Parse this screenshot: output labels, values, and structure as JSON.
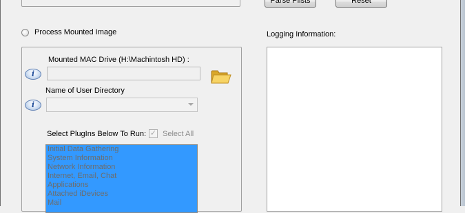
{
  "toolbar": {
    "parse_label": "Parse Plists",
    "reset_label": "Reset"
  },
  "process_mounted": {
    "label": "Process Mounted Image",
    "checked": false
  },
  "mounted_drive": {
    "label": "Mounted MAC Drive (H:\\Machintosh HD) :",
    "value": ""
  },
  "user_directory": {
    "label": "Name of User Directory",
    "value": ""
  },
  "plugins": {
    "label": "Select PlugIns Below To Run:",
    "select_all_label": "Select All",
    "select_all_checked": true,
    "items": [
      "Initial Data Gathering",
      "System Information",
      "Network Information",
      "Internet, Email, Chat",
      "Applications",
      "Attached iDevices",
      "Mail"
    ]
  },
  "logging": {
    "label": "Logging Information:",
    "content": ""
  },
  "icons": {
    "info": "info-icon",
    "folder": "folder-open-icon",
    "check": "✓",
    "info_glyph": "i"
  },
  "colors": {
    "selection": "#3399ff",
    "window_bg": "#f0f0f0"
  }
}
